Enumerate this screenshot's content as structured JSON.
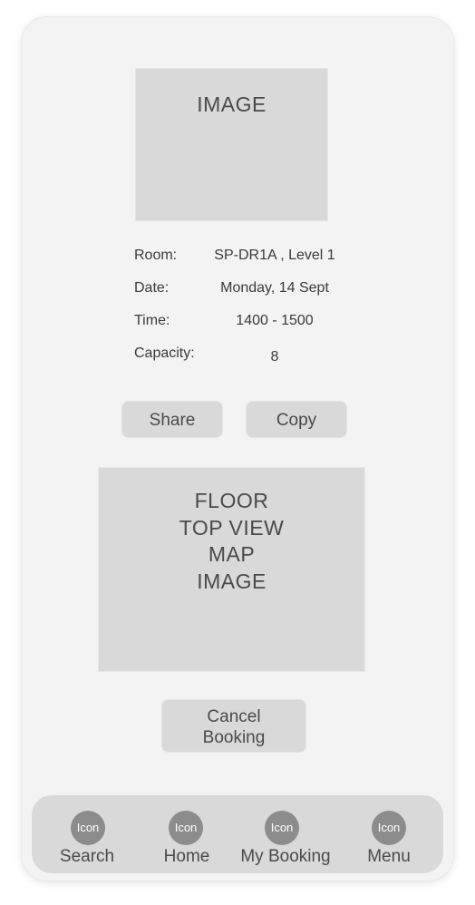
{
  "hero": {
    "label": "IMAGE"
  },
  "details": [
    {
      "label": "Room:",
      "value": "SP-DR1A , Level 1"
    },
    {
      "label": "Date:",
      "value": "Monday, 14 Sept"
    },
    {
      "label": "Time:",
      "value": "1400 - 1500"
    },
    {
      "label": "Capacity:",
      "value": "8"
    }
  ],
  "actions": {
    "share_label": "Share",
    "copy_label": "Copy"
  },
  "map": {
    "label": "FLOOR\nTOP VIEW\nMAP\nIMAGE"
  },
  "cancel": {
    "label": "Cancel\nBooking"
  },
  "nav": [
    {
      "icon": "Icon",
      "label": "Search"
    },
    {
      "icon": "Icon",
      "label": "Home"
    },
    {
      "icon": "Icon",
      "label": "My Booking"
    },
    {
      "icon": "Icon",
      "label": "Menu"
    }
  ]
}
